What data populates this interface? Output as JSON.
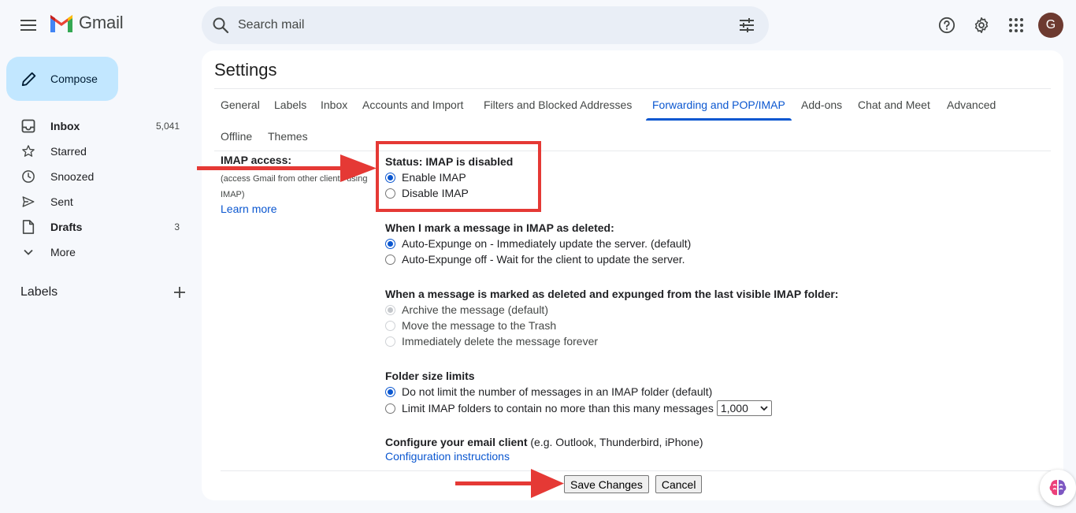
{
  "app": {
    "name": "Gmail"
  },
  "search": {
    "placeholder": "Search mail"
  },
  "user": {
    "avatar_letter": "G"
  },
  "compose": {
    "label": "Compose"
  },
  "sidebar": {
    "items": [
      {
        "label": "Inbox",
        "count": "5,041",
        "icon": "inbox-icon"
      },
      {
        "label": "Starred",
        "count": "",
        "icon": "star-icon"
      },
      {
        "label": "Snoozed",
        "count": "",
        "icon": "clock-icon"
      },
      {
        "label": "Sent",
        "count": "",
        "icon": "send-icon"
      },
      {
        "label": "Drafts",
        "count": "3",
        "icon": "draft-icon"
      },
      {
        "label": "More",
        "count": "",
        "icon": "chevron-down-icon"
      }
    ],
    "labels_heading": "Labels"
  },
  "settings": {
    "title": "Settings",
    "tabs": [
      "General",
      "Labels",
      "Inbox",
      "Accounts and Import",
      "Filters and Blocked Addresses",
      "Forwarding and POP/IMAP",
      "Add-ons",
      "Chat and Meet",
      "Advanced",
      "Offline",
      "Themes"
    ],
    "active_tab": "Forwarding and POP/IMAP",
    "imap": {
      "label": "IMAP access:",
      "description_line1": "(access Gmail from other clients using",
      "description_line2": "IMAP)",
      "learn_more": "Learn more",
      "status": "Status: IMAP is disabled",
      "enable": "Enable IMAP",
      "disable": "Disable IMAP"
    },
    "deleted": {
      "title": "When I mark a message in IMAP as deleted:",
      "opt_on": "Auto-Expunge on - Immediately update the server. (default)",
      "opt_off": "Auto-Expunge off - Wait for the client to update the server."
    },
    "expunged": {
      "title": "When a message is marked as deleted and expunged from the last visible IMAP folder:",
      "opt_archive": "Archive the message (default)",
      "opt_trash": "Move the message to the Trash",
      "opt_delete": "Immediately delete the message forever"
    },
    "folder_limits": {
      "title": "Folder size limits",
      "opt_nolimit": "Do not limit the number of messages in an IMAP folder (default)",
      "opt_limit": "Limit IMAP folders to contain no more than this many messages",
      "selected_value": "1,000"
    },
    "client": {
      "title": "Configure your email client",
      "examples": "(e.g. Outlook, Thunderbird, iPhone)",
      "link": "Configuration instructions"
    },
    "buttons": {
      "save": "Save Changes",
      "cancel": "Cancel"
    }
  },
  "colors": {
    "accent": "#0b57d0",
    "annotation": "#e53935",
    "compose_bg": "#c2e7ff"
  }
}
